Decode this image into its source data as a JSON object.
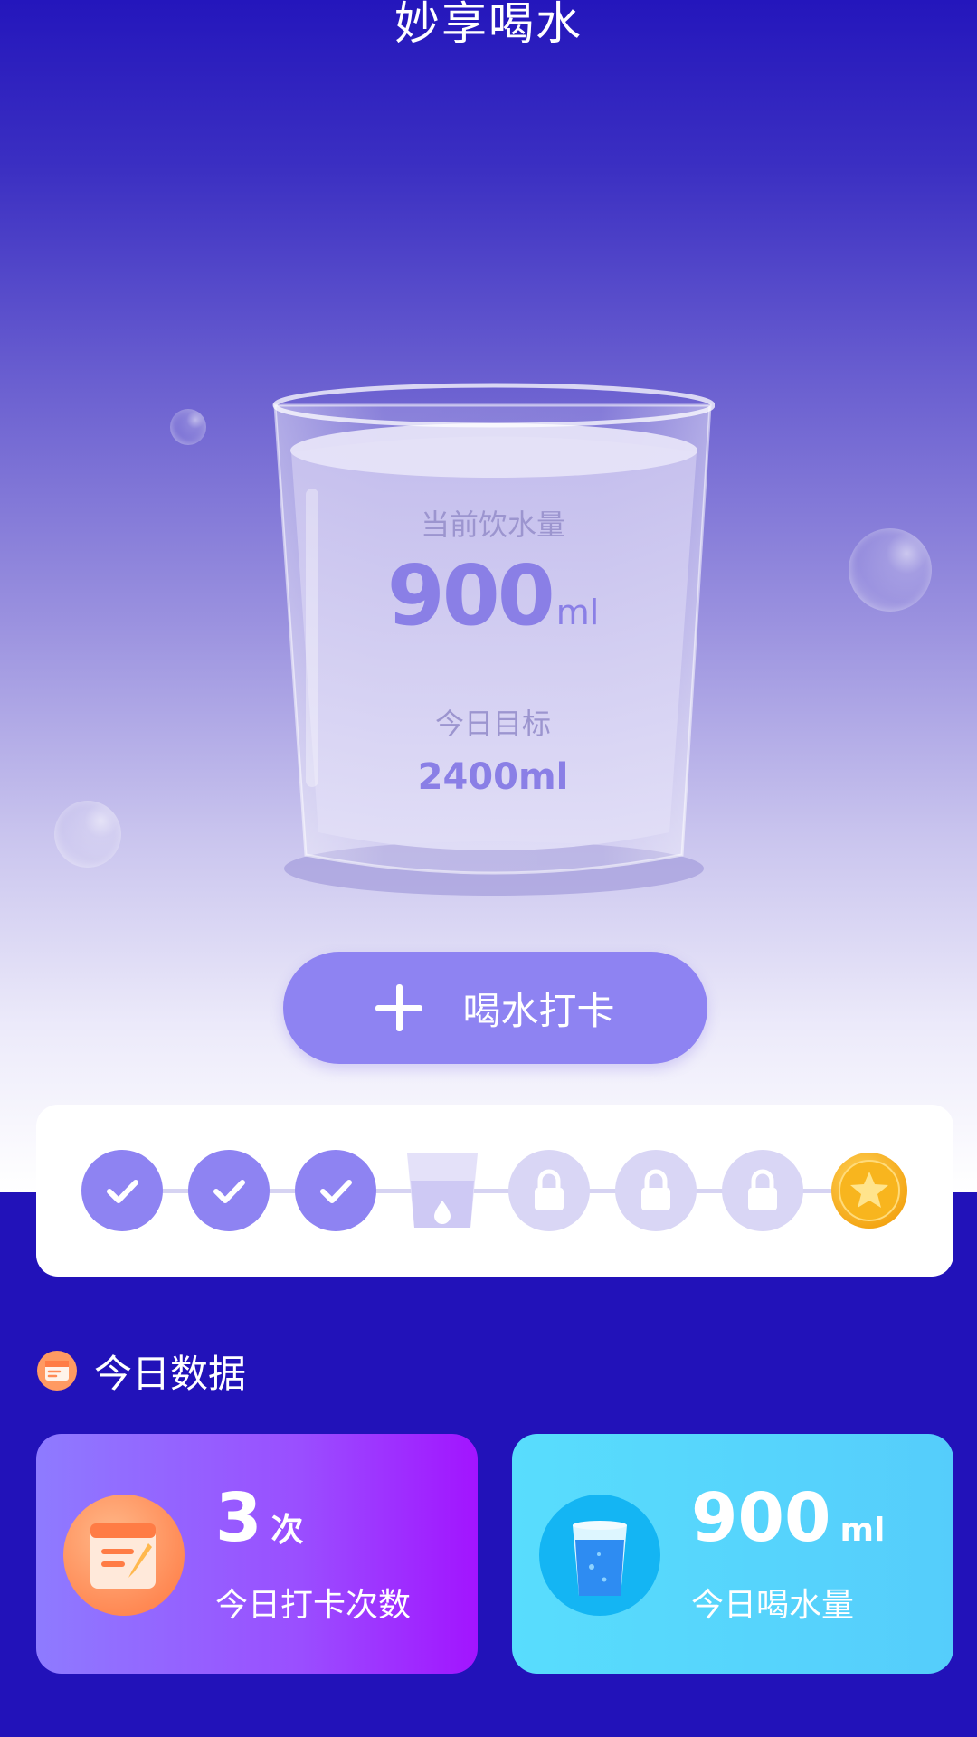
{
  "app": {
    "title": "妙享喝水"
  },
  "glass": {
    "current_label": "当前饮水量",
    "current_value": "900",
    "current_unit": "ml",
    "goal_label": "今日目标",
    "goal_value": "2400ml"
  },
  "checkin_button": {
    "label": "喝水打卡",
    "icon": "plus-icon"
  },
  "progress": {
    "slots": [
      {
        "state": "done",
        "icon": "check-icon"
      },
      {
        "state": "done",
        "icon": "check-icon"
      },
      {
        "state": "done",
        "icon": "check-icon"
      },
      {
        "state": "current",
        "icon": "water-cup-icon"
      },
      {
        "state": "locked",
        "icon": "lock-icon"
      },
      {
        "state": "locked",
        "icon": "lock-icon"
      },
      {
        "state": "locked",
        "icon": "lock-icon"
      },
      {
        "state": "reward",
        "icon": "star-coin-icon"
      }
    ]
  },
  "today": {
    "section_title": "今日数据",
    "checkins": {
      "value": "3",
      "unit": "次",
      "label": "今日打卡次数",
      "icon": "notepad-icon"
    },
    "intake": {
      "value": "900",
      "unit": "ml",
      "label": "今日喝水量",
      "icon": "water-glass-icon"
    }
  },
  "colors": {
    "accent": "#8E83F2",
    "bottom_background": "#2212B9",
    "checkins_card": "#A214FF",
    "intake_card": "#55CDFB"
  }
}
